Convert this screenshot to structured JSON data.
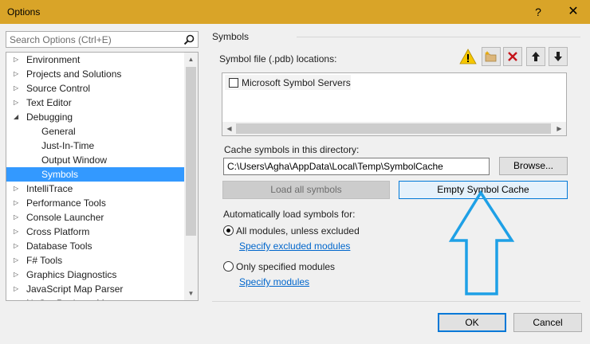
{
  "window": {
    "title": "Options",
    "help_glyph": "?",
    "close_glyph": "✕"
  },
  "search": {
    "placeholder": "Search Options (Ctrl+E)"
  },
  "tree": {
    "items": [
      {
        "label": "Environment",
        "level": 0,
        "expanded": false
      },
      {
        "label": "Projects and Solutions",
        "level": 0,
        "expanded": false
      },
      {
        "label": "Source Control",
        "level": 0,
        "expanded": false
      },
      {
        "label": "Text Editor",
        "level": 0,
        "expanded": false
      },
      {
        "label": "Debugging",
        "level": 0,
        "expanded": true
      },
      {
        "label": "General",
        "level": 1
      },
      {
        "label": "Just-In-Time",
        "level": 1
      },
      {
        "label": "Output Window",
        "level": 1
      },
      {
        "label": "Symbols",
        "level": 1,
        "selected": true
      },
      {
        "label": "IntelliTrace",
        "level": 0,
        "expanded": false
      },
      {
        "label": "Performance Tools",
        "level": 0,
        "expanded": false
      },
      {
        "label": "Console Launcher",
        "level": 0,
        "expanded": false
      },
      {
        "label": "Cross Platform",
        "level": 0,
        "expanded": false
      },
      {
        "label": "Database Tools",
        "level": 0,
        "expanded": false
      },
      {
        "label": "F# Tools",
        "level": 0,
        "expanded": false
      },
      {
        "label": "Graphics Diagnostics",
        "level": 0,
        "expanded": false
      },
      {
        "label": "JavaScript Map Parser",
        "level": 0,
        "expanded": false
      },
      {
        "label": "NuGet Package Manager",
        "level": 0,
        "expanded": false
      }
    ]
  },
  "symbols": {
    "section_title": "Symbols",
    "locations_label": "Symbol file (.pdb) locations:",
    "toolbar_icons": [
      "warning-icon",
      "new-folder-icon",
      "delete-icon",
      "move-up-icon",
      "move-down-icon"
    ],
    "locations": [
      {
        "label": "Microsoft Symbol Servers",
        "checked": false
      }
    ],
    "cache_label": "Cache symbols in this directory:",
    "cache_path": "C:\\Users\\Agha\\AppData\\Local\\Temp\\SymbolCache",
    "browse_label": "Browse...",
    "load_all_label": "Load all symbols",
    "empty_cache_label": "Empty Symbol Cache",
    "auto_load_label": "Automatically load symbols for:",
    "option_all": "All modules, unless excluded",
    "link_excluded": "Specify excluded modules",
    "option_specified": "Only specified modules",
    "link_specify": "Specify modules",
    "selected_option": "all"
  },
  "footer": {
    "ok_label": "OK",
    "cancel_label": "Cancel"
  },
  "colors": {
    "titlebar": "#d9a428",
    "selection": "#3399ff",
    "accent": "#0078d7",
    "annotation_arrow": "#1ea0e6",
    "link": "#0066cc"
  }
}
